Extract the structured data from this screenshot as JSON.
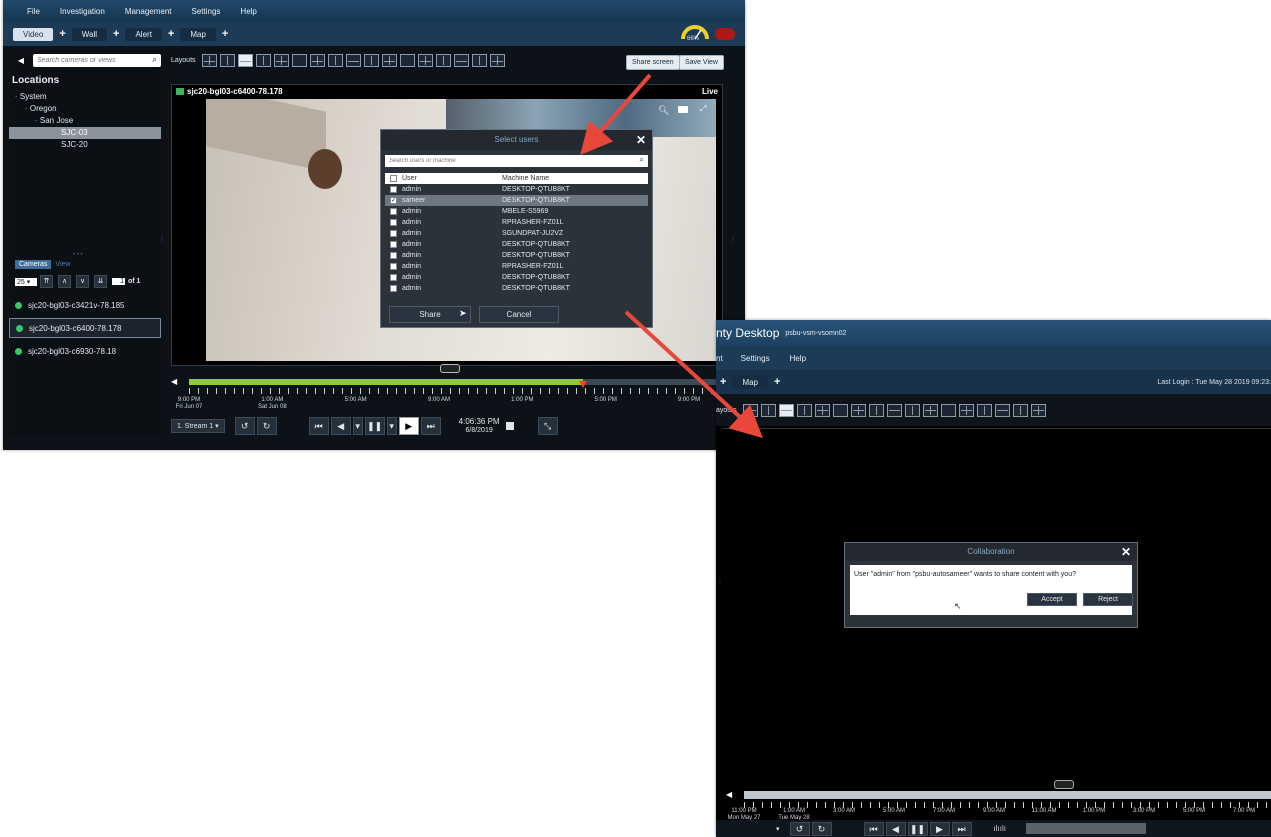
{
  "main": {
    "menu": [
      "File",
      "Investigation",
      "Management",
      "Settings",
      "Help"
    ],
    "tabs": [
      {
        "label": "Video"
      },
      {
        "label": "Wall"
      },
      {
        "label": "Alert"
      },
      {
        "label": "Map"
      }
    ],
    "gauge_label": "66%",
    "search_placeholder": "Search cameras or views",
    "locations_title": "Locations",
    "tree": [
      "System",
      "Oregon",
      "San Jose",
      "SJC-03",
      "SJC-20"
    ],
    "side_tabs": [
      "Cameras",
      "View"
    ],
    "page_size": "25",
    "page_num": "1",
    "page_of": "of 1",
    "cameras": [
      "sjc20-bgl03-c3421v-78.185",
      "sjc20-bgl03-c6400-78.178",
      "sjc20-bgl03-c6930-78.18"
    ],
    "layouts_label": "Layouts",
    "share_screen": "Share screen",
    "save_view": "Save View",
    "camera_title": "sjc20-bgl03-c6400-78.178",
    "live": "Live",
    "timeline": [
      {
        "t": "9:00 PM",
        "d": "Fri Jun 07"
      },
      {
        "t": "1:00 AM",
        "d": "Sat Jun 08"
      },
      {
        "t": "5:00 AM",
        "d": ""
      },
      {
        "t": "9:00 AM",
        "d": ""
      },
      {
        "t": "1:00 PM",
        "d": ""
      },
      {
        "t": "5:00 PM",
        "d": ""
      },
      {
        "t": "9:00 PM",
        "d": ""
      }
    ],
    "stream": "1. Stream 1",
    "time": "4:06:36 PM",
    "date": "6/8/2019",
    "progress": 0.74
  },
  "select_users": {
    "title": "Select users",
    "search_placeholder": "Search users or machine",
    "col_user": "User",
    "col_machine": "Machine Name",
    "rows": [
      {
        "user": "admin",
        "machine": "DESKTOP-QTUB8KT",
        "checked": false
      },
      {
        "user": "sameer",
        "machine": "DESKTOP-QTUB8KT",
        "checked": true
      },
      {
        "user": "admin",
        "machine": "MBELE-S5969",
        "checked": false
      },
      {
        "user": "admin",
        "machine": "RPRASHER-FZ01L",
        "checked": false
      },
      {
        "user": "admin",
        "machine": "SGUNDPAT-JU2VZ",
        "checked": false
      },
      {
        "user": "admin",
        "machine": "DESKTOP-QTUB8KT",
        "checked": false
      },
      {
        "user": "admin",
        "machine": "DESKTOP-QTUB8KT",
        "checked": false
      },
      {
        "user": "admin",
        "machine": "RPRASHER-FZ01L",
        "checked": false
      },
      {
        "user": "admin",
        "machine": "DESKTOP-QTUB8KT",
        "checked": false
      },
      {
        "user": "admin",
        "machine": "DESKTOP-QTUB8KT",
        "checked": false
      }
    ],
    "share": "Share",
    "cancel": "Cancel"
  },
  "second": {
    "title": "nty Desktop",
    "host": "psbu-vsm-vsomn02",
    "menu": [
      "nt",
      "Settings",
      "Help"
    ],
    "tab": "Map",
    "last_login": "Last Login : Tue May 28 2019 09:23:",
    "layouts_label": "ayouts",
    "timeline": [
      {
        "t": "11:00 PM",
        "d": "Mon May 27"
      },
      {
        "t": "1:00 AM",
        "d": "Tue May 28"
      },
      {
        "t": "3:00 AM",
        "d": ""
      },
      {
        "t": "5:00 AM",
        "d": ""
      },
      {
        "t": "7:00 AM",
        "d": ""
      },
      {
        "t": "9:00 AM",
        "d": ""
      },
      {
        "t": "11:00 AM",
        "d": ""
      },
      {
        "t": "1:00 PM",
        "d": ""
      },
      {
        "t": "3:00 PM",
        "d": ""
      },
      {
        "t": "5:00 PM",
        "d": ""
      },
      {
        "t": "7:00 PM",
        "d": ""
      }
    ]
  },
  "collab": {
    "title": "Collaboration",
    "message": "User \"admin\" from \"psbu-autosameer\" wants to share content with you?",
    "accept": "Accept",
    "reject": "Reject"
  },
  "colors": {
    "arrow": "#e8483a",
    "progress": "#8fcf2a",
    "accent": "#89a7c6"
  }
}
